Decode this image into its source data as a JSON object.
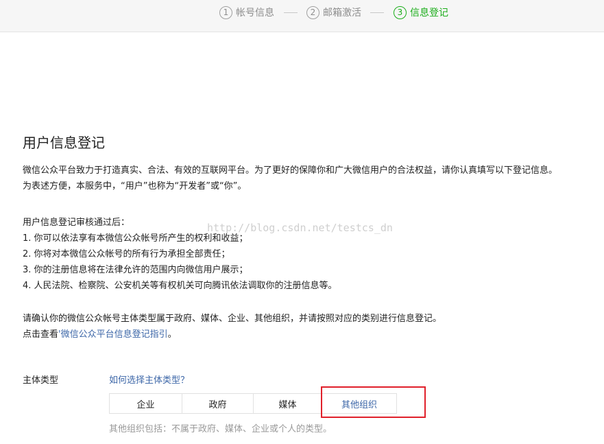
{
  "steps": [
    {
      "num": "1",
      "label": "帐号信息"
    },
    {
      "num": "2",
      "label": "邮箱激活"
    },
    {
      "num": "3",
      "label": "信息登记"
    }
  ],
  "colors": {
    "active_step": "#1aad19",
    "link": "#3d67a8",
    "highlight_box": "#e0202a"
  },
  "page": {
    "title": "用户信息登记",
    "intro": [
      "微信公众平台致力于打造真实、合法、有效的互联网平台。为了更好的保障你和广大微信用户的合法权益，请你认真填写以下登记信息。",
      "为表述方便，本服务中，“用户”也称为“开发者”或“你”。"
    ],
    "terms": [
      "用户信息登记审核通过后：",
      "1. 你可以依法享有本微信公众帐号所产生的权利和收益；",
      "2. 你将对本微信公众帐号的所有行为承担全部责任；",
      "3. 你的注册信息将在法律允许的范围内向微信用户展示；",
      "4. 人民法院、检察院、公安机关等有权机关可向腾讯依法调取你的注册信息等。"
    ],
    "confirm": "请确认你的微信公众帐号主体类型属于政府、媒体、企业、其他组织，并请按照对应的类别进行信息登记。",
    "guide_prefix": "点击查看",
    "guide_link": "'微信公众平台信息登记指引",
    "guide_suffix": "。"
  },
  "watermark": "http://blog.csdn.net/testcs_dn",
  "entity": {
    "label": "主体类型",
    "help_link": "如何选择主体类型？",
    "options": [
      "企业",
      "政府",
      "媒体",
      "其他组织"
    ],
    "selected": "其他组织",
    "note": "其他组织包括：不属于政府、媒体、企业或个人的类型。"
  }
}
